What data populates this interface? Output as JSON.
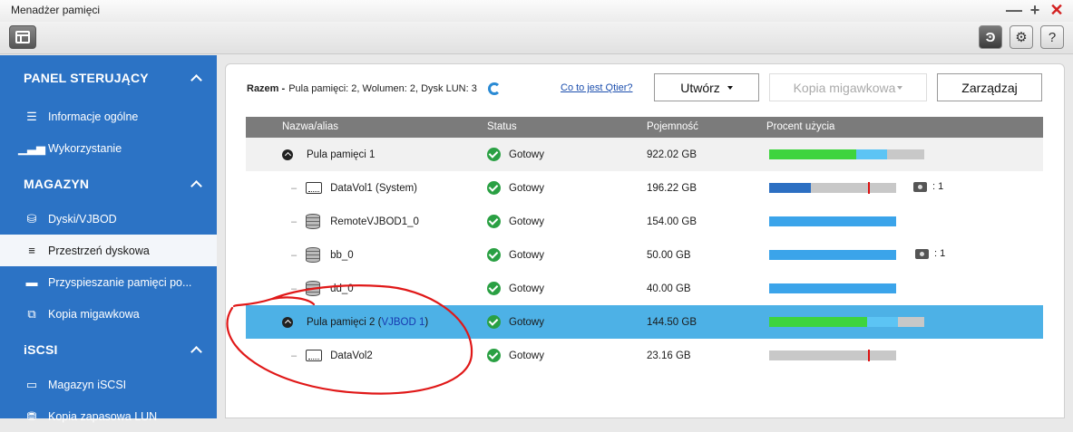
{
  "window": {
    "title": "Menadżer pamięci",
    "controls": {
      "minimize": "—",
      "maximize": "+",
      "close": "✕"
    }
  },
  "toolbar": {
    "right_icons": [
      "qtier-icon",
      "gear-icon",
      "help-icon"
    ],
    "help_label": "?"
  },
  "sidebar": {
    "sections": [
      {
        "title": "PANEL STERUJĄCY",
        "items": [
          {
            "label": "Informacje ogólne",
            "icon": "overview-icon"
          },
          {
            "label": "Wykorzystanie",
            "icon": "usage-chart-icon"
          }
        ]
      },
      {
        "title": "MAGAZYN",
        "items": [
          {
            "label": "Dyski/VJBOD",
            "icon": "disk-icon"
          },
          {
            "label": "Przestrzeń dyskowa",
            "icon": "storage-space-icon",
            "active": true
          },
          {
            "label": "Przyspieszanie pamięci po...",
            "icon": "cache-icon"
          },
          {
            "label": "Kopia migawkowa",
            "icon": "snapshot-icon"
          }
        ]
      },
      {
        "title": "iSCSI",
        "items": [
          {
            "label": "Magazyn iSCSI",
            "icon": "iscsi-storage-icon"
          },
          {
            "label": "Kopia zapasowa LUN",
            "icon": "lun-backup-icon"
          }
        ]
      }
    ]
  },
  "summary": {
    "prefix": "Razem -",
    "text": "Pula pamięci: 2, Wolumen: 2, Dysk LUN: 3"
  },
  "links": {
    "qtier": "Co to jest Qtier?"
  },
  "buttons": {
    "create": "Utwórz",
    "snapshot": "Kopia migawkowa",
    "manage": "Zarządzaj"
  },
  "table": {
    "headers": [
      "Nazwa/alias",
      "Status",
      "Pojemność",
      "Procent użycia"
    ],
    "rows": [
      {
        "type": "pool",
        "name": "Pula pamięci 1",
        "status": "Gotowy",
        "capacity": "922.02 GB",
        "usage": {
          "used": 0.56,
          "reserved": 0.2
        }
      },
      {
        "type": "volume",
        "name": "DataVol1 (System)",
        "status": "Gotowy",
        "capacity": "196.22 GB",
        "usage": {
          "used": 0.33,
          "threshold": 0.78
        },
        "snapshots": ": 1"
      },
      {
        "type": "lun",
        "name": "RemoteVJBOD1_0",
        "status": "Gotowy",
        "capacity": "154.00 GB",
        "usage": {
          "used": 1.0
        }
      },
      {
        "type": "lun",
        "name": "bb_0",
        "status": "Gotowy",
        "capacity": "50.00 GB",
        "usage": {
          "used": 1.0
        },
        "snapshots": ": 1"
      },
      {
        "type": "lun",
        "name": "dd_0",
        "status": "Gotowy",
        "capacity": "40.00 GB",
        "usage": {
          "used": 1.0
        }
      },
      {
        "type": "pool",
        "name": "Pula pamięci 2 (",
        "name_link": "VJBOD 1",
        "name_suffix": ")",
        "status": "Gotowy",
        "capacity": "144.50 GB",
        "selected": true,
        "usage": {
          "used": 0.63,
          "reserved": 0.2
        }
      },
      {
        "type": "volume",
        "name": "DataVol2",
        "status": "Gotowy",
        "capacity": "23.16 GB",
        "usage": {
          "used": 0.0,
          "threshold": 0.78
        }
      }
    ]
  },
  "colors": {
    "sidebar": "#2c73c5",
    "selected_row": "#4db1e6",
    "bar_green": "#3ed43e",
    "bar_lightblue": "#5cc4f4",
    "bar_blue": "#2c6fc2",
    "bar_lun": "#3ba4ea",
    "annotation": "#e01818"
  }
}
